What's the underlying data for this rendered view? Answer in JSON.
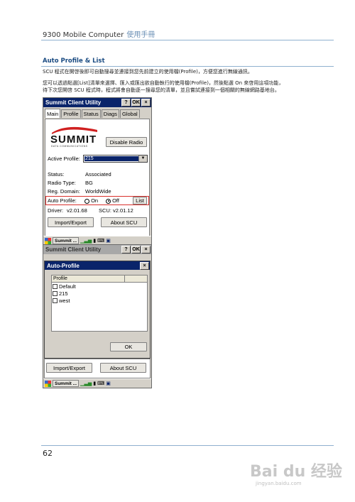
{
  "header": {
    "title": "9300 Mobile Computer",
    "subtitle": "使用手冊"
  },
  "section": {
    "title": "Auto Profile & List",
    "para1": "SCU 程式在開啓後即可自動搜尋並連接到您先前建立的使用檔(Profile)，方便您進行無線通訊。",
    "para2a": "您可以透過點選[List]清單來選擇、匯入或匯出欲自動執行的使用檔(Profile)，然後點選 On 來啓用這項功能，",
    "para2b": "待下次您開啓 SCU 程式時，程式將會自動逐一搜尋您的清單，並且嘗試連接到一個相關的無線網路基地台。"
  },
  "screen1": {
    "title": "Summit Client Utility",
    "title_buttons": [
      "?",
      "OK",
      "×"
    ],
    "tabs": [
      "Main",
      "Profile",
      "Status",
      "Diags",
      "Global"
    ],
    "logo_text": "SUMMIT",
    "logo_sub": "DATA COMMUNICATIONS",
    "disable_radio": "Disable Radio",
    "active_profile_label": "Active Profile:",
    "active_profile_value": "215",
    "status_label": "Status:",
    "status_value": "Associated",
    "radio_type_label": "Radio Type:",
    "radio_type_value": "BG",
    "reg_domain_label": "Reg. Domain:",
    "reg_domain_value": "WorldWide",
    "auto_profile_label": "Auto Profile:",
    "on_label": "On",
    "off_label": "Off",
    "list_button": "List",
    "driver_label": "Driver:",
    "driver_value": "v2.01.68",
    "scu_label": "SCU:",
    "scu_value": "v2.01.12",
    "import_export": "Import/Export",
    "about_scu": "About SCU",
    "taskbar_app": "Summit ..."
  },
  "screen2": {
    "title": "Summit Client Utility",
    "title_buttons": [
      "?",
      "OK",
      "×"
    ],
    "dialog_title": "Auto-Profile",
    "dialog_close": "×",
    "list_header": "Profile",
    "profiles": [
      "Default",
      "215",
      "west"
    ],
    "ok_button": "OK",
    "import_export": "Import/Export",
    "about_scu": "About SCU",
    "taskbar_app": "Summit ..."
  },
  "footer": {
    "page_number": "62"
  },
  "watermark": {
    "brand": "Bai du 经验",
    "url": "jingyan.baidu.com"
  },
  "colors": {
    "accent": "#1a4b82",
    "titlebar": "#0a246a",
    "highlight": "#d9302c",
    "rule": "#8fb0cf"
  }
}
